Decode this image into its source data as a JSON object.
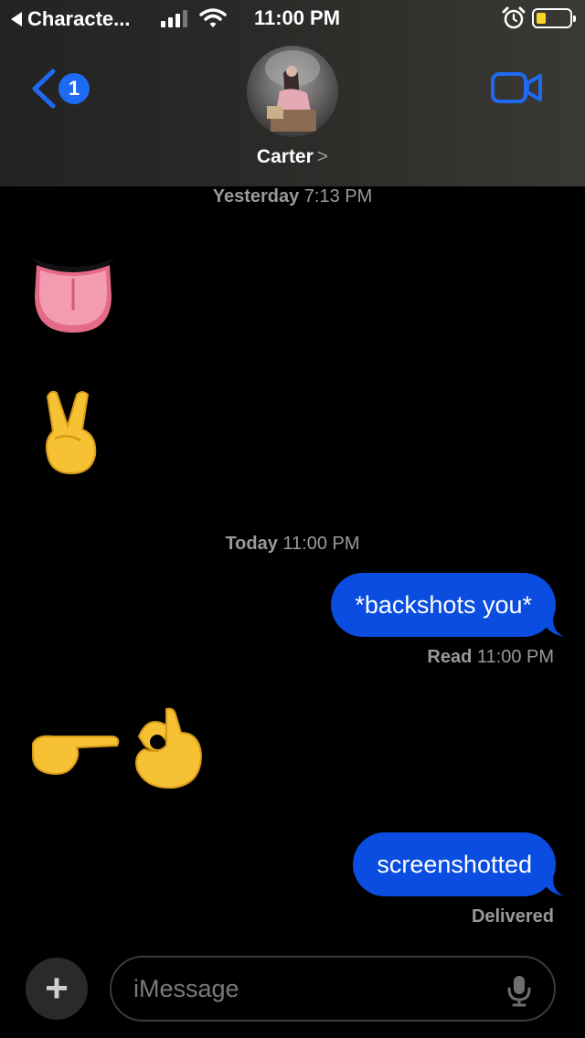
{
  "status_bar": {
    "back_app_label": "Characte...",
    "time": "11:00",
    "time_suffix": "PM"
  },
  "header": {
    "unread_count": "1",
    "contact_name": "Carter",
    "contact_chevron": ">"
  },
  "messages": {
    "timestamp_1_day": "Yesterday",
    "timestamp_1_time": "7:13 PM",
    "received_1": "👅",
    "received_2": "✌️",
    "timestamp_2_day": "Today",
    "timestamp_2_time": "11:00 PM",
    "sent_1": "*backshots you*",
    "read_label": "Read",
    "read_time": "11:00 PM",
    "received_3": "👉👌",
    "sent_2": "screenshotted",
    "delivered_label": "Delivered"
  },
  "composer": {
    "placeholder": "iMessage",
    "plus_label": "+"
  },
  "icons": {
    "back": "chevron-left-icon",
    "video": "video-camera-icon",
    "mic": "microphone-icon",
    "alarm": "alarm-clock-icon",
    "wifi": "wifi-icon"
  },
  "colors": {
    "accent": "#1f6af2",
    "bubble": "#0a4de0",
    "background": "#000000",
    "battery_low": "#f7d42a"
  }
}
